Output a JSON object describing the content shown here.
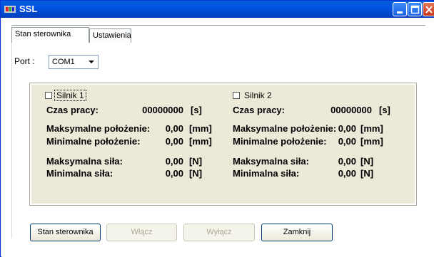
{
  "window": {
    "title": "SSL"
  },
  "tabs": [
    {
      "label": "Stan sterownika",
      "active": true
    },
    {
      "label": "Ustawienia",
      "active": false
    }
  ],
  "port": {
    "label": "Port :",
    "value": "COM1"
  },
  "motor1": {
    "name": "Silnik 1",
    "checked": false,
    "work_time_label": "Czas pracy:",
    "work_time_value": "00000000",
    "work_time_unit": "[s]",
    "max_pos_label": "Maksymalne położenie:",
    "max_pos_value": "0,00",
    "max_pos_unit": "[mm]",
    "min_pos_label": "Minimalne położenie:",
    "min_pos_value": "0,00",
    "min_pos_unit": "[mm]",
    "max_force_label": "Maksymalna siła:",
    "max_force_value": "0,00",
    "max_force_unit": "[N]",
    "min_force_label": "Minimalna siła:",
    "min_force_value": "0,00",
    "min_force_unit": "[N]"
  },
  "motor2": {
    "name": "Silnik 2",
    "checked": false,
    "work_time_label": "Czas pracy:",
    "work_time_value": "00000000",
    "work_time_unit": "[s]",
    "max_pos_label": "Maksymalne położenie:",
    "max_pos_value": "0,00",
    "max_pos_unit": "[mm]",
    "min_pos_label": "Minimalne położenie:",
    "min_pos_value": "0,00",
    "min_pos_unit": "[mm]",
    "max_force_label": "Maksymalna siła:",
    "max_force_value": "0,00",
    "max_force_unit": "[N]",
    "min_force_label": "Minimalna siła:",
    "min_force_value": "0,00",
    "min_force_unit": "[N]"
  },
  "buttons": {
    "status": "Stan sterownika",
    "on": "Włącz",
    "off": "Wyłącz",
    "close": "Zamknij"
  },
  "colors": {
    "titlebar": "#0054e3",
    "groupbox": "#ece9d8"
  }
}
